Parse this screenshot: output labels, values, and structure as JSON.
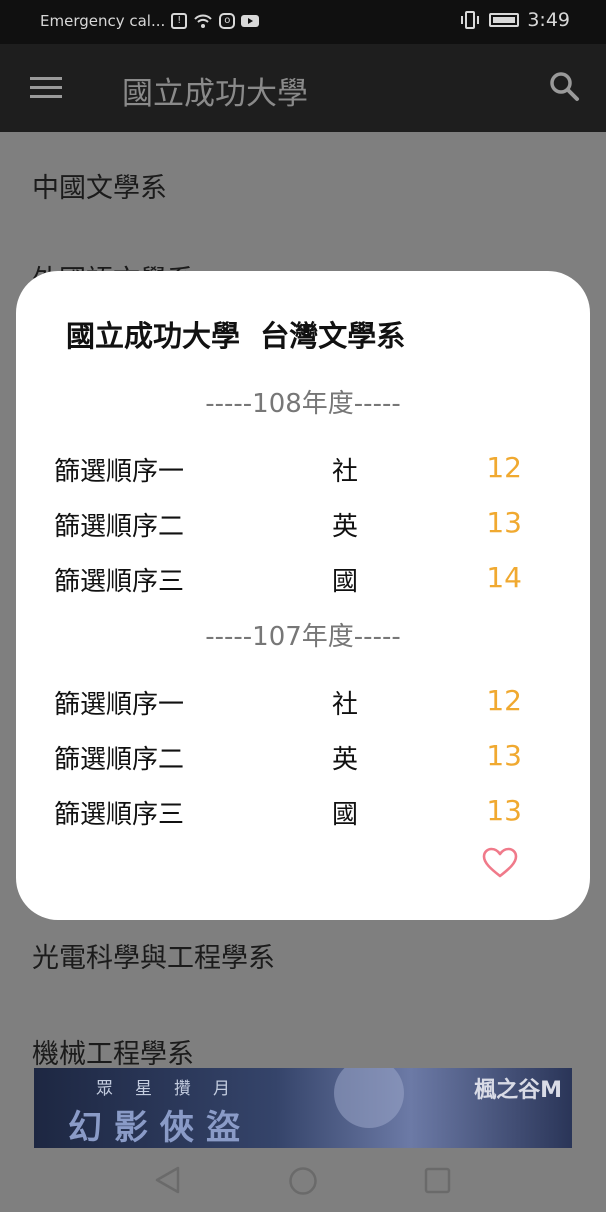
{
  "status_bar": {
    "left_text": "Emergency cal...",
    "time": "3:49",
    "icons": [
      "alert-icon",
      "wifi-icon",
      "instagram-icon",
      "youtube-icon",
      "vibrate-icon",
      "battery-icon"
    ]
  },
  "app_bar": {
    "title": "國立成功大學",
    "icons": [
      "menu-icon",
      "search-icon"
    ]
  },
  "list": {
    "items": [
      "中國文學系",
      "外國語文學系",
      "光電科學與工程學系",
      "機械工程學系"
    ]
  },
  "dialog": {
    "title": "國立成功大學  台灣文學系",
    "sections": [
      {
        "header": "-----108年度-----",
        "rows": [
          {
            "label": "篩選順序一",
            "subject": "社",
            "value": "12"
          },
          {
            "label": "篩選順序二",
            "subject": "英",
            "value": "13"
          },
          {
            "label": "篩選順序三",
            "subject": "國",
            "value": "14"
          }
        ]
      },
      {
        "header": "-----107年度-----",
        "rows": [
          {
            "label": "篩選順序一",
            "subject": "社",
            "value": "12"
          },
          {
            "label": "篩選順序二",
            "subject": "英",
            "value": "13"
          },
          {
            "label": "篩選順序三",
            "subject": "國",
            "value": "13"
          }
        ]
      }
    ],
    "favorite_icon": "heart-outline-icon",
    "value_color": "#f0a930",
    "heart_color": "#f07a8a"
  },
  "ad": {
    "small_text": "眾星攢月",
    "big_text": "幻影俠盜",
    "brand": "楓之谷M"
  },
  "nav_bar": {
    "icons": [
      "back-icon",
      "home-icon",
      "recents-icon"
    ]
  }
}
